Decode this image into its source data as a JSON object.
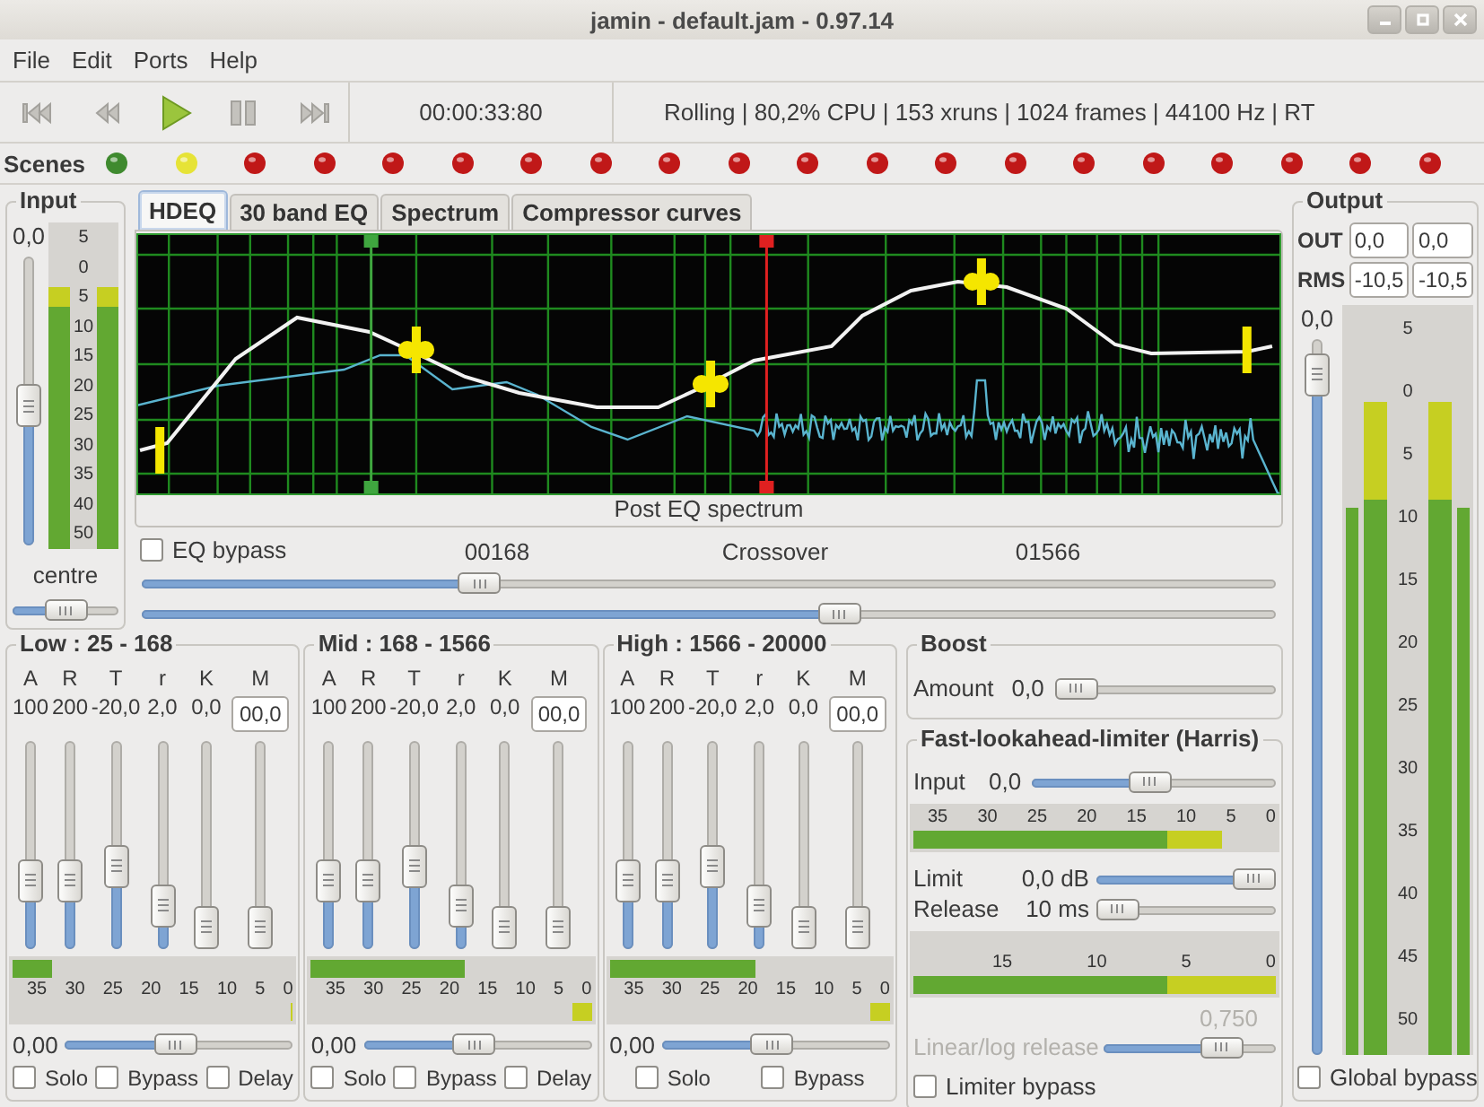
{
  "window": {
    "title": "jamin - default.jam - 0.97.14"
  },
  "menu": [
    {
      "label": "File"
    },
    {
      "label": "Edit"
    },
    {
      "label": "Ports"
    },
    {
      "label": "Help"
    }
  ],
  "transport": {
    "buttons": [
      {
        "kind": "start",
        "disabled": true
      },
      {
        "kind": "rewind",
        "disabled": true
      },
      {
        "kind": "play",
        "disabled": false
      },
      {
        "kind": "pause",
        "disabled": true
      },
      {
        "kind": "end",
        "disabled": true
      }
    ],
    "time": "00:00:33:80",
    "status": "Rolling | 80,2% CPU | 153 xruns | 1024 frames | 44100 Hz | RT"
  },
  "scenes": {
    "label": "Scenes",
    "lights": [
      {
        "color": "#3f8a2f"
      },
      {
        "color": "#e6e337"
      },
      {
        "color": "#c01818"
      },
      {
        "color": "#c01818"
      },
      {
        "color": "#c01818"
      },
      {
        "color": "#c01818"
      },
      {
        "color": "#c01818"
      },
      {
        "color": "#c01818"
      },
      {
        "color": "#c01818"
      },
      {
        "color": "#c01818"
      },
      {
        "color": "#c01818"
      },
      {
        "color": "#c01818"
      },
      {
        "color": "#c01818"
      },
      {
        "color": "#c01818"
      },
      {
        "color": "#c01818"
      },
      {
        "color": "#c01818"
      },
      {
        "color": "#c01818"
      },
      {
        "color": "#c01818"
      },
      {
        "color": "#c01818"
      },
      {
        "color": "#c01818"
      }
    ]
  },
  "input": {
    "title": "Input",
    "value": "0,0",
    "gain": {
      "level": 0.48
    },
    "scale": [
      "5",
      "0",
      "5",
      "10",
      "15",
      "20",
      "25",
      "30",
      "35",
      "40",
      "50"
    ],
    "meters": [
      {
        "level": 0.8
      },
      {
        "level": 0.8
      }
    ],
    "balance_label": "centre",
    "balance": {
      "level": 0.5
    }
  },
  "tabs": [
    {
      "label": "HDEQ",
      "selected": true
    },
    {
      "label": "30 band EQ",
      "selected": false
    },
    {
      "label": "Spectrum",
      "selected": false
    },
    {
      "label": "Compressor curves",
      "selected": false
    }
  ],
  "eq_graph": {
    "caption": "Post EQ spectrum"
  },
  "crossover": {
    "bypass": {
      "label": "EQ bypass",
      "checked": false
    },
    "low": "00168",
    "label": "Crossover",
    "high": "01566",
    "sliders": [
      {
        "level": 0.29
      },
      {
        "level": 0.62
      }
    ]
  },
  "bands": [
    {
      "title": "Low : 25 - 168",
      "controls": [
        {
          "label": "A",
          "value": "100",
          "level": 0.28
        },
        {
          "label": "R",
          "value": "200",
          "level": 0.28
        },
        {
          "label": "T",
          "value": "-20,0",
          "level": 0.37
        },
        {
          "label": "r",
          "value": "2,0",
          "level": 0.13
        },
        {
          "label": "K",
          "value": "0,0",
          "level": 0
        }
      ],
      "makeup": {
        "label": "M",
        "value": "00,0",
        "level": 0
      },
      "meter": {
        "level": 0.14,
        "reduction": {
          "level": 0.01
        },
        "scale": [
          "35",
          "30",
          "25",
          "20",
          "15",
          "10",
          "5",
          "0"
        ]
      },
      "gain": {
        "value": "0,00",
        "level": 0.48
      },
      "checkboxes": [
        {
          "label": "Solo",
          "checked": false
        },
        {
          "label": "Bypass",
          "checked": false
        },
        {
          "label": "Delay",
          "checked": false
        }
      ]
    },
    {
      "title": "Mid : 168 - 1566",
      "controls": [
        {
          "label": "A",
          "value": "100",
          "level": 0.28
        },
        {
          "label": "R",
          "value": "200",
          "level": 0.28
        },
        {
          "label": "T",
          "value": "-20,0",
          "level": 0.37
        },
        {
          "label": "r",
          "value": "2,0",
          "level": 0.13
        },
        {
          "label": "K",
          "value": "0,0",
          "level": 0
        }
      ],
      "makeup": {
        "label": "M",
        "value": "00,0",
        "level": 0
      },
      "meter": {
        "level": 0.55,
        "reduction": {
          "level": 0.07
        },
        "scale": [
          "35",
          "30",
          "25",
          "20",
          "15",
          "10",
          "5",
          "0"
        ]
      },
      "gain": {
        "value": "0,00",
        "level": 0.48
      },
      "checkboxes": [
        {
          "label": "Solo",
          "checked": false
        },
        {
          "label": "Bypass",
          "checked": false
        },
        {
          "label": "Delay",
          "checked": false
        }
      ]
    },
    {
      "title": "High : 1566 - 20000",
      "controls": [
        {
          "label": "A",
          "value": "100",
          "level": 0.28
        },
        {
          "label": "R",
          "value": "200",
          "level": 0.28
        },
        {
          "label": "T",
          "value": "-20,0",
          "level": 0.37
        },
        {
          "label": "r",
          "value": "2,0",
          "level": 0.13
        },
        {
          "label": "K",
          "value": "0,0",
          "level": 0
        }
      ],
      "makeup": {
        "label": "M",
        "value": "00,0",
        "level": 0
      },
      "meter": {
        "level": 0.52,
        "reduction": {
          "level": 0.07
        },
        "scale": [
          "35",
          "30",
          "25",
          "20",
          "15",
          "10",
          "5",
          "0"
        ]
      },
      "gain": {
        "value": "0,00",
        "level": 0.48
      },
      "checkboxes": [
        {
          "label": "Solo",
          "checked": false
        },
        {
          "label": "Bypass",
          "checked": false
        }
      ]
    }
  ],
  "boost": {
    "title": "Boost",
    "label": "Amount",
    "value": "0,0",
    "level": 0
  },
  "limiter": {
    "title": "Fast-lookahead-limiter (Harris)",
    "input": {
      "label": "Input",
      "value": "0,0",
      "level": 0.48
    },
    "input_meter": {
      "scale": [
        "35",
        "30",
        "25",
        "20",
        "15",
        "10",
        "5",
        "0"
      ],
      "level": 0.85
    },
    "limit": {
      "label": "Limit",
      "value": "0,0 dB",
      "level": 1
    },
    "release": {
      "label": "Release",
      "value": "10 ms",
      "level": 0
    },
    "attenuation_meter": {
      "scale": [
        "15",
        "10",
        "5",
        "0"
      ],
      "level": 1
    },
    "release_curve": {
      "label": "Linear/log release",
      "value": "0,750",
      "level": 0.75,
      "disabled": true
    },
    "bypass": {
      "label": "Limiter bypass",
      "checked": false
    }
  },
  "output": {
    "title": "Output",
    "readouts": [
      {
        "label": "OUT",
        "values": [
          "0,0",
          "0,0"
        ]
      },
      {
        "label": "RMS",
        "values": [
          "-10,5",
          "-10,5"
        ]
      }
    ],
    "value": "0,0",
    "gain": {
      "level": 0.98
    },
    "scale": [
      "5",
      "0",
      "5",
      "10",
      "15",
      "20",
      "25",
      "30",
      "35",
      "40",
      "45",
      "50"
    ],
    "meters": [
      {
        "kind": "thin",
        "level": 0.73
      },
      {
        "kind": "wide",
        "level": 0.87
      },
      {
        "kind": "wide",
        "level": 0.87
      },
      {
        "kind": "thin",
        "level": 0.73
      }
    ],
    "bypass": {
      "label": "Global bypass",
      "checked": false
    }
  }
}
